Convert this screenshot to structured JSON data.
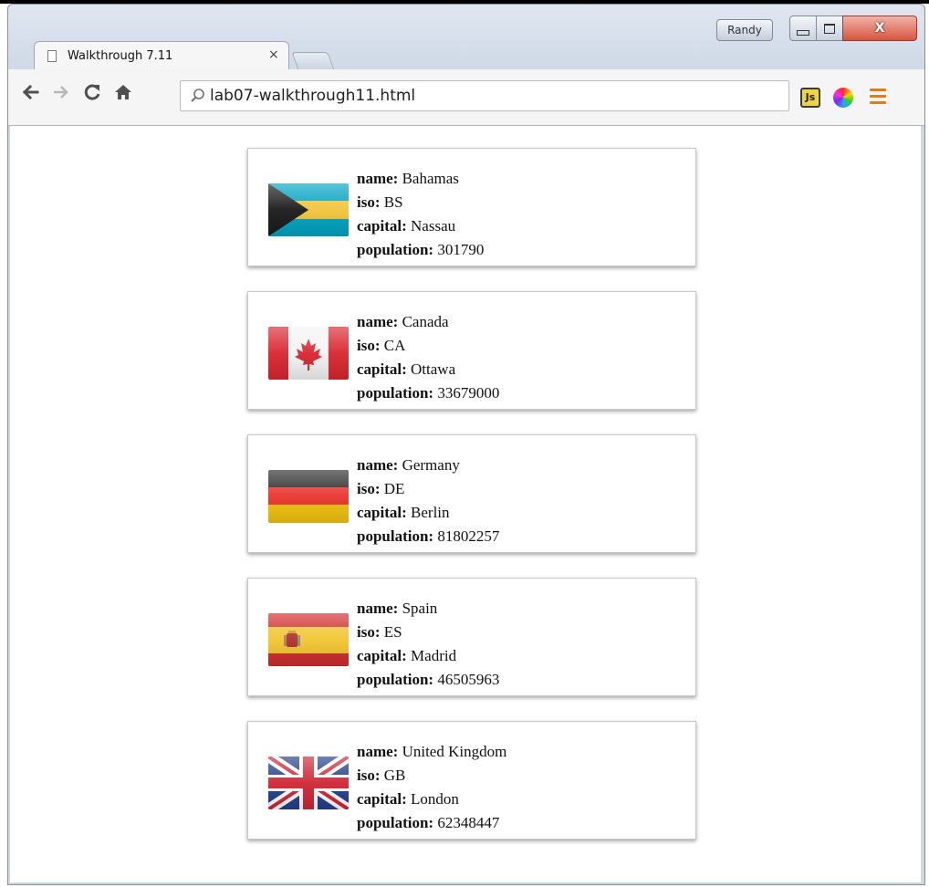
{
  "window": {
    "user_label": "Randy",
    "close_glyph": "X"
  },
  "tabs": [
    {
      "title": "Walkthrough 7.11",
      "close_glyph": "×"
    }
  ],
  "toolbar": {
    "url": "lab07-walkthrough11.html",
    "js_extension_label": "Js"
  },
  "field_labels": {
    "name": "name:",
    "iso": "iso:",
    "capital": "capital:",
    "population": "population:"
  },
  "countries": [
    {
      "name": "Bahamas",
      "iso": "BS",
      "capital": "Nassau",
      "population": "301790",
      "flag_icon": "bahamas-flag"
    },
    {
      "name": "Canada",
      "iso": "CA",
      "capital": "Ottawa",
      "population": "33679000",
      "flag_icon": "canada-flag"
    },
    {
      "name": "Germany",
      "iso": "DE",
      "capital": "Berlin",
      "population": "81802257",
      "flag_icon": "germany-flag"
    },
    {
      "name": "Spain",
      "iso": "ES",
      "capital": "Madrid",
      "population": "46505963",
      "flag_icon": "spain-flag"
    },
    {
      "name": "United Kingdom",
      "iso": "GB",
      "capital": "London",
      "population": "62348447",
      "flag_icon": "united-kingdom-flag"
    }
  ]
}
